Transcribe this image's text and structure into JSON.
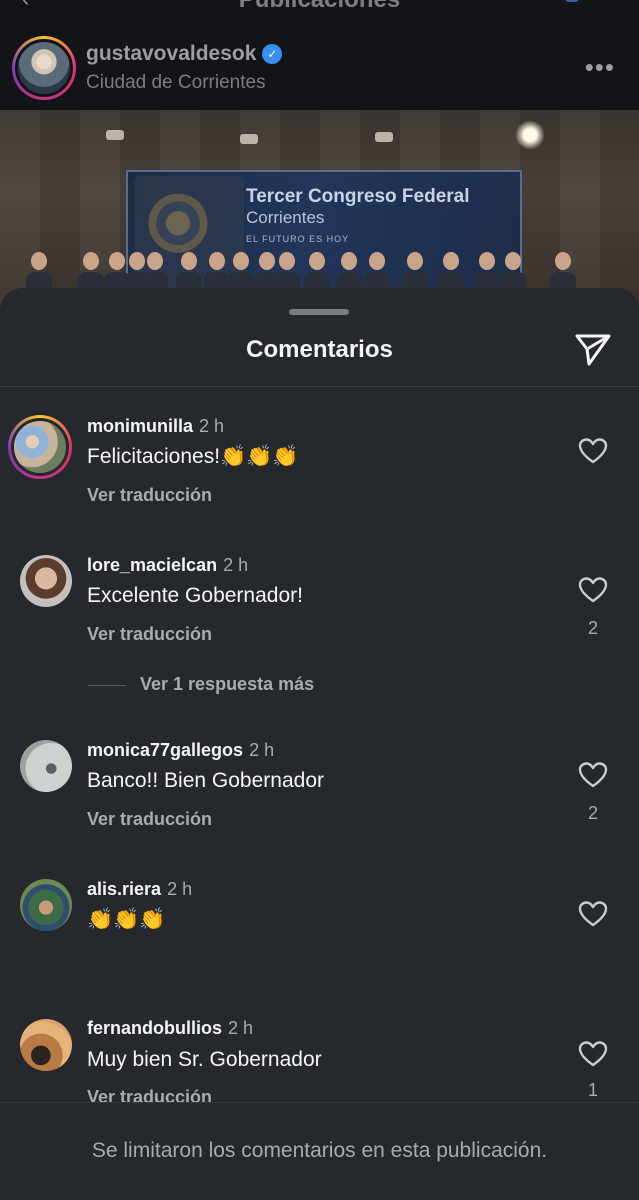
{
  "background": {
    "header_title": "Publicaciones",
    "post": {
      "username": "gustavovaldesok",
      "location": "Ciudad de Corrientes",
      "more_label": "•••",
      "banner": {
        "line1": "Tercer Congreso Federal",
        "line2": "Corrientes",
        "line3": "EL FUTURO ES HOY"
      }
    }
  },
  "sheet": {
    "title": "Comentarios",
    "comments": [
      {
        "username": "monimunilla",
        "time": "2 h",
        "text": "Felicitaciones!👏👏👏",
        "translate": "Ver traducción",
        "likes": ""
      },
      {
        "username": "lore_macielcan",
        "time": "2 h",
        "text": "Excelente Gobernador!",
        "translate": "Ver traducción",
        "likes": "2",
        "replies": "Ver 1 respuesta más"
      },
      {
        "username": "monica77gallegos",
        "time": "2 h",
        "text": "Banco!! Bien Gobernador",
        "translate": "Ver traducción",
        "likes": "2"
      },
      {
        "username": "alis.riera",
        "time": "2 h",
        "text": "👏👏👏",
        "likes": ""
      },
      {
        "username": "fernandobullios",
        "time": "2 h",
        "text": "Muy bien Sr. Gobernador",
        "translate": "Ver traducción",
        "likes": "1"
      }
    ],
    "footer": "Se limitaron los comentarios en esta publicación."
  },
  "colors": {
    "sheet_bg": "#25282d",
    "primary_text": "#f5f5f5",
    "secondary_text": "#a8abb0",
    "verified": "#3a8ef0"
  },
  "icons": [
    "back-chevron-icon",
    "verified-icon",
    "more-icon",
    "share-send-icon",
    "heart-icon"
  ]
}
